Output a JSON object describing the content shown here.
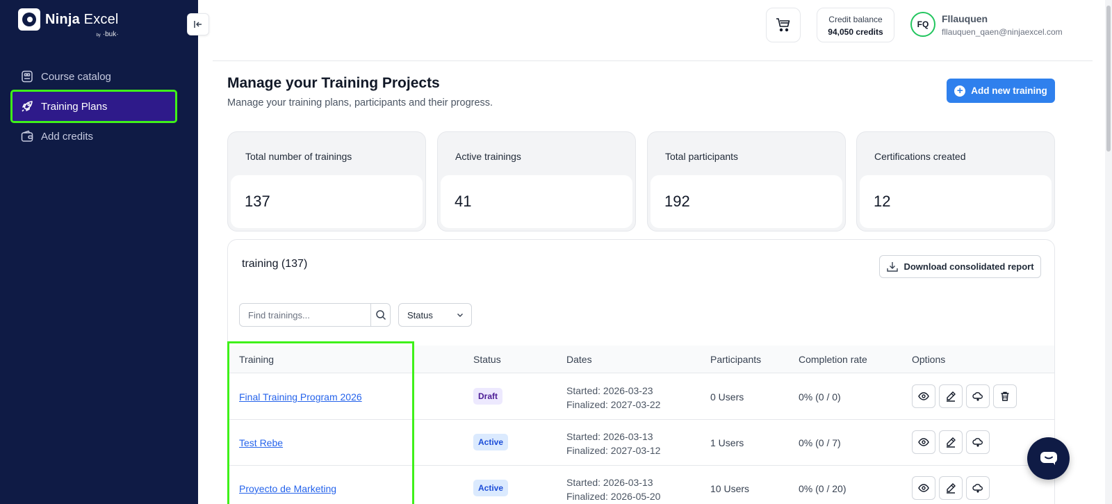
{
  "brand": {
    "name_bold": "Ninja",
    "name_rest": " Excel",
    "by_prefix": "by",
    "by_name": "·buk·"
  },
  "sidebar": {
    "items": [
      {
        "label": "Course catalog",
        "icon": "catalog-icon",
        "active": false
      },
      {
        "label": "Training Plans",
        "icon": "rocket-icon",
        "active": true
      },
      {
        "label": "Add credits",
        "icon": "wallet-icon",
        "active": false
      }
    ]
  },
  "header": {
    "credit_title": "Credit balance",
    "credit_value": "94,050 credits",
    "avatar_initials": "FQ",
    "user_name": "Fllauquen",
    "user_email": "fllauquen_qaen@ninjaexcel.com"
  },
  "page": {
    "title": "Manage your Training Projects",
    "subtitle": "Manage your training plans, participants and their progress.",
    "add_button": "Add new training"
  },
  "stats": [
    {
      "label": "Total number of trainings",
      "value": "137"
    },
    {
      "label": "Active trainings",
      "value": "41"
    },
    {
      "label": "Total participants",
      "value": "192"
    },
    {
      "label": "Certifications created",
      "value": "12"
    }
  ],
  "table": {
    "title": "training (137)",
    "download_label": "Download consolidated report",
    "search_placeholder": "Find trainings...",
    "status_filter": "Status",
    "columns": [
      "Training",
      "Status",
      "Dates",
      "Participants",
      "Completion rate",
      "Options"
    ],
    "rows": [
      {
        "name": "Final Training Program 2026",
        "status": "Draft",
        "started": "Started: 2026-03-23",
        "finalized": "Finalized: 2027-03-22",
        "participants": "0 Users",
        "completion": "0% (0 / 0)"
      },
      {
        "name": "Test Rebe",
        "status": "Active",
        "started": "Started: 2026-03-13",
        "finalized": "Finalized: 2027-03-12",
        "participants": "1 Users",
        "completion": "0% (0 / 7)"
      },
      {
        "name": "Proyecto de Marketing",
        "status": "Active",
        "started": "Started: 2026-03-13",
        "finalized": "Finalized: 2026-05-20",
        "participants": "10 Users",
        "completion": "0% (0 / 20)"
      }
    ]
  },
  "colors": {
    "sidebar_bg": "#0f1b45",
    "active_item": "#2e1a8a",
    "accent": "#2f80ed",
    "highlight": "#3ff11a"
  }
}
